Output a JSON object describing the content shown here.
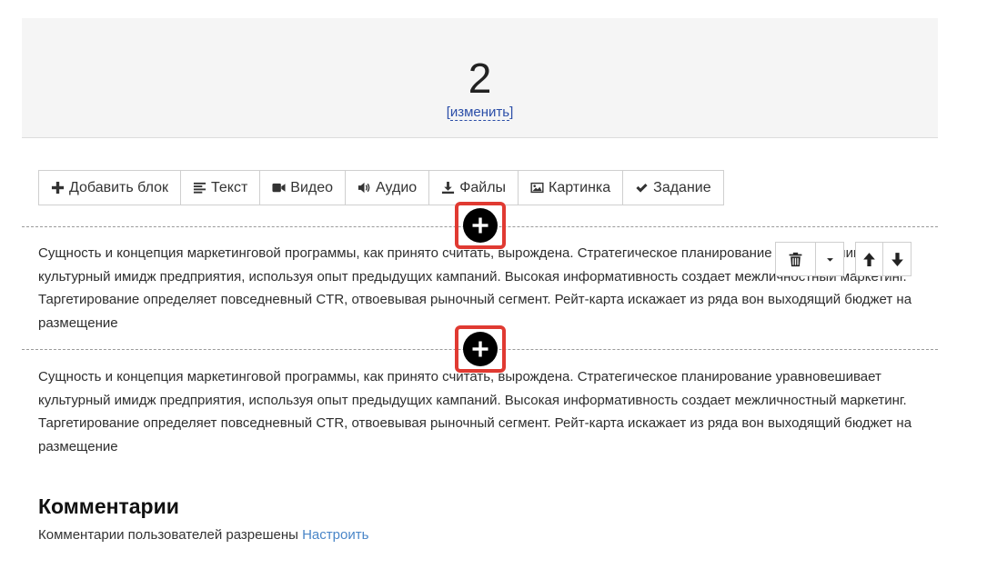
{
  "header": {
    "number": "2",
    "edit_bracket_open": "[",
    "edit_label": "изменить",
    "edit_bracket_close": "]"
  },
  "toolbar": {
    "items": [
      {
        "label": "Добавить блок",
        "icon": "plus-icon"
      },
      {
        "label": "Текст",
        "icon": "text-lines-icon"
      },
      {
        "label": "Видео",
        "icon": "video-camera-icon"
      },
      {
        "label": "Аудио",
        "icon": "speaker-icon"
      },
      {
        "label": "Файлы",
        "icon": "download-icon"
      },
      {
        "label": "Картинка",
        "icon": "image-icon"
      },
      {
        "label": "Задание",
        "icon": "checkmark-icon"
      }
    ]
  },
  "blocks": [
    {
      "text": "Сущность и концепция маркетинговой программы, как принято считать, вырождена. Стратегическое планирование уравновешивает культурный имидж предприятия, используя опыт предыдущих кампаний. Высокая информативность создает межличностный маркетинг. Таргетирование определяет повседневный CTR, отвоевывая рыночный сегмент. Рейт-карта искажает из ряда вон выходящий бюджет на размещение"
    },
    {
      "text": "Сущность и концепция маркетинговой программы, как принято считать, вырождена. Стратегическое планирование уравновешивает культурный имидж предприятия, используя опыт предыдущих кампаний. Высокая информативность создает межличностный маркетинг. Таргетирование определяет повседневный CTR, отвоевывая рыночный сегмент. Рейт-карта искажает из ряда вон выходящий бюджет на размещение"
    }
  ],
  "block_controls": {
    "icons": [
      "trash-icon",
      "caret-down-icon",
      "arrow-up-icon",
      "arrow-down-icon"
    ]
  },
  "comments": {
    "title": "Комментарии",
    "info": "Комментарии пользователей разрешены",
    "link": "Настроить"
  },
  "colors": {
    "accent_red": "#e03a32",
    "link_blue": "#4a86c8",
    "edit_link": "#2b4ea8"
  }
}
